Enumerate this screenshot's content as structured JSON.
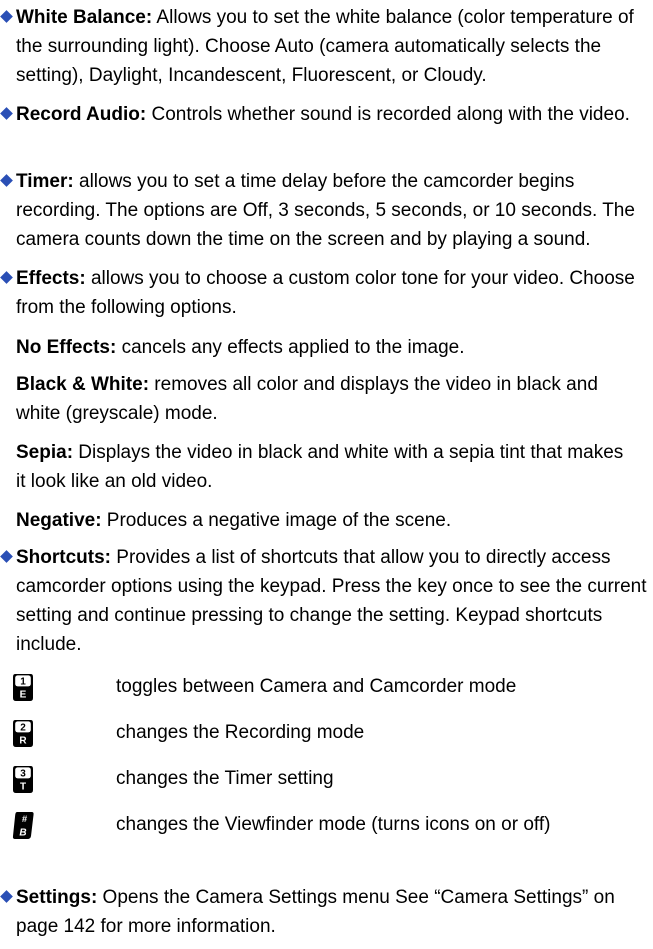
{
  "bullets": {
    "white_balance": {
      "term": "White Balance:",
      "body": " Allows you to set the white balance (color temperature of the surrounding light). Choose Auto (camera automatically selects the setting), Daylight, Incandescent, Fluorescent, or Cloudy."
    },
    "record_audio": {
      "term": "Record Audio:",
      "body": " Controls whether sound is recorded along with the video."
    },
    "timer": {
      "term": "Timer:",
      "body": " allows you to set a time delay before the camcorder begins recording. The options are Off, 3 seconds, 5 seconds, or 10 seconds. The camera counts down the time on the screen and by playing a sound."
    },
    "effects": {
      "term": "Effects:",
      "body": " allows you to choose a custom color tone for your video. Choose from the following options."
    },
    "shortcuts": {
      "term": "Shortcuts:",
      "body": " Provides a list of shortcuts that allow you to directly access camcorder options using the keypad. Press the key once to see the current setting and continue pressing to change the setting. Keypad shortcuts include."
    },
    "settings": {
      "term": "Settings:",
      "body": " Opens the Camera Settings menu See “Camera Settings” on page 142 for more information."
    }
  },
  "effects_options": {
    "no_effects": {
      "term": "No Effects:",
      "body": " cancels any effects applied to the image."
    },
    "black_white": {
      "term": "Black & White:",
      "body": " removes all color and displays the video in black and white (greyscale) mode."
    },
    "sepia": {
      "term": "Sepia:",
      "body": " Displays the video in black and white with a sepia tint that makes it look like an old video."
    },
    "negative": {
      "term": "Negative:",
      "body": " Produces a negative image of the scene."
    }
  },
  "shortcut_keys": [
    {
      "icon": "key-1-icon",
      "top": "1",
      "bottom": "E",
      "description": "toggles between Camera and Camcorder mode"
    },
    {
      "icon": "key-2-icon",
      "top": "2",
      "bottom": "R",
      "description": "changes the Recording mode"
    },
    {
      "icon": "key-3-icon",
      "top": "3",
      "bottom": "T",
      "description": "changes the Timer setting"
    },
    {
      "icon": "key-hash-icon",
      "top": "#",
      "bottom": "B",
      "description": "changes the Viewfinder mode (turns icons on or off)"
    }
  ],
  "colors": {
    "bullet": "#2a4fb5",
    "text": "#000000",
    "background": "#ffffff"
  }
}
